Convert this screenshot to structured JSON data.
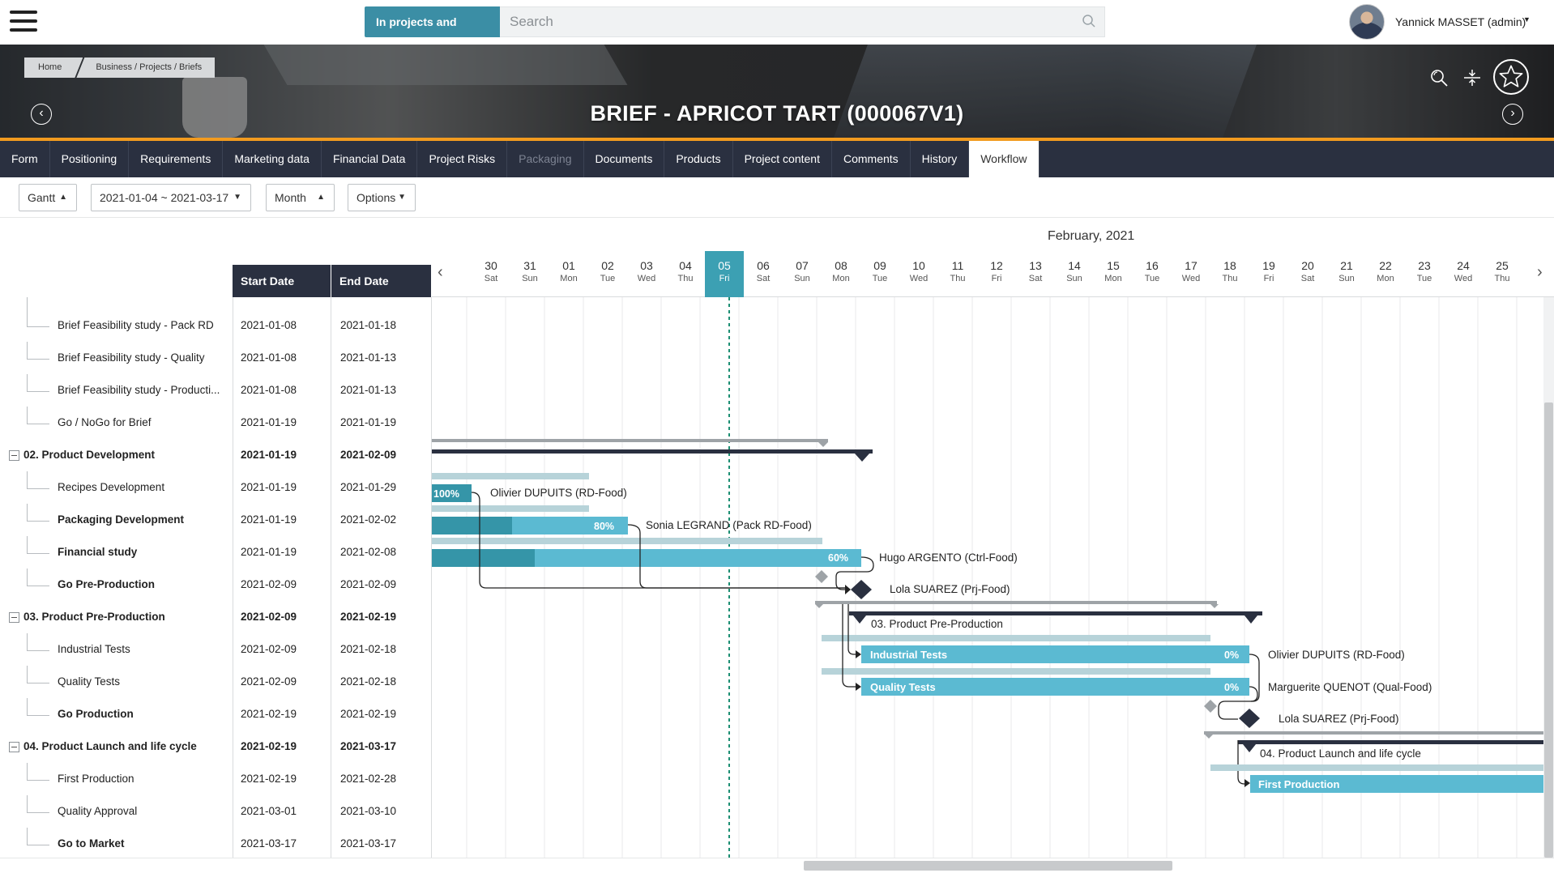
{
  "topbar": {
    "search_scope": "In projects and briefs",
    "search_placeholder": "Search",
    "user_name": "Yannick MASSET (admin)"
  },
  "banner": {
    "breadcrumb": [
      "Home",
      "Business / Projects / Briefs"
    ],
    "title": "BRIEF - APRICOT TART (000067V1)"
  },
  "tabs": [
    {
      "label": "Form",
      "state": "normal"
    },
    {
      "label": "Positioning",
      "state": "normal"
    },
    {
      "label": "Requirements",
      "state": "normal"
    },
    {
      "label": "Marketing data",
      "state": "normal"
    },
    {
      "label": "Financial Data",
      "state": "normal"
    },
    {
      "label": "Project Risks",
      "state": "normal"
    },
    {
      "label": "Packaging",
      "state": "disabled"
    },
    {
      "label": "Documents",
      "state": "normal"
    },
    {
      "label": "Products",
      "state": "normal"
    },
    {
      "label": "Project content",
      "state": "normal"
    },
    {
      "label": "Comments",
      "state": "normal"
    },
    {
      "label": "History",
      "state": "normal"
    },
    {
      "label": "Workflow",
      "state": "active"
    }
  ],
  "toolbar": {
    "view": "Gantt",
    "date_range": "2021-01-04 ~ 2021-03-17",
    "scale": "Month",
    "options": "Options"
  },
  "gantt": {
    "month_title": "February, 2021",
    "columns": {
      "start": "Start Date",
      "end": "End Date"
    },
    "days": [
      {
        "n": "30",
        "w": "Sat"
      },
      {
        "n": "31",
        "w": "Sun"
      },
      {
        "n": "01",
        "w": "Mon"
      },
      {
        "n": "02",
        "w": "Tue"
      },
      {
        "n": "03",
        "w": "Wed"
      },
      {
        "n": "04",
        "w": "Thu"
      },
      {
        "n": "05",
        "w": "Fri",
        "today": true
      },
      {
        "n": "06",
        "w": "Sat"
      },
      {
        "n": "07",
        "w": "Sun"
      },
      {
        "n": "08",
        "w": "Mon"
      },
      {
        "n": "09",
        "w": "Tue"
      },
      {
        "n": "10",
        "w": "Wed"
      },
      {
        "n": "11",
        "w": "Thu"
      },
      {
        "n": "12",
        "w": "Fri"
      },
      {
        "n": "13",
        "w": "Sat"
      },
      {
        "n": "14",
        "w": "Sun"
      },
      {
        "n": "15",
        "w": "Mon"
      },
      {
        "n": "16",
        "w": "Tue"
      },
      {
        "n": "17",
        "w": "Wed"
      },
      {
        "n": "18",
        "w": "Thu"
      },
      {
        "n": "19",
        "w": "Fri"
      },
      {
        "n": "20",
        "w": "Sat"
      },
      {
        "n": "21",
        "w": "Sun"
      },
      {
        "n": "22",
        "w": "Mon"
      },
      {
        "n": "23",
        "w": "Tue"
      },
      {
        "n": "24",
        "w": "Wed"
      },
      {
        "n": "25",
        "w": "Thu"
      }
    ],
    "rows": [
      {
        "name": "Brief Feasibility study - Pack RD",
        "start": "2021-01-08",
        "end": "2021-01-18",
        "kind": "task"
      },
      {
        "name": "Brief Feasibility study - Quality",
        "start": "2021-01-08",
        "end": "2021-01-13",
        "kind": "task"
      },
      {
        "name": "Brief Feasibility study - Producti...",
        "start": "2021-01-08",
        "end": "2021-01-13",
        "kind": "task"
      },
      {
        "name": "Go / NoGo for Brief",
        "start": "2021-01-19",
        "end": "2021-01-19",
        "kind": "task"
      },
      {
        "name": "02. Product Development",
        "start": "2021-01-19",
        "end": "2021-02-09",
        "kind": "group"
      },
      {
        "name": "Recipes Development",
        "start": "2021-01-19",
        "end": "2021-01-29",
        "kind": "task"
      },
      {
        "name": "Packaging Development",
        "start": "2021-01-19",
        "end": "2021-02-02",
        "kind": "bold"
      },
      {
        "name": "Financial study",
        "start": "2021-01-19",
        "end": "2021-02-08",
        "kind": "bold"
      },
      {
        "name": "Go Pre-Production",
        "start": "2021-02-09",
        "end": "2021-02-09",
        "kind": "bold"
      },
      {
        "name": "03. Product Pre-Production",
        "start": "2021-02-09",
        "end": "2021-02-19",
        "kind": "group"
      },
      {
        "name": "Industrial Tests",
        "start": "2021-02-09",
        "end": "2021-02-18",
        "kind": "task"
      },
      {
        "name": "Quality Tests",
        "start": "2021-02-09",
        "end": "2021-02-18",
        "kind": "task"
      },
      {
        "name": "Go Production",
        "start": "2021-02-19",
        "end": "2021-02-19",
        "kind": "bold"
      },
      {
        "name": "04. Product Launch and life cycle",
        "start": "2021-02-19",
        "end": "2021-03-17",
        "kind": "group"
      },
      {
        "name": "First Production",
        "start": "2021-02-19",
        "end": "2021-02-28",
        "kind": "task"
      },
      {
        "name": "Quality Approval",
        "start": "2021-03-01",
        "end": "2021-03-10",
        "kind": "task"
      },
      {
        "name": "Go to Market",
        "start": "2021-03-17",
        "end": "2021-03-17",
        "kind": "bold"
      }
    ],
    "bars": [
      {
        "label": "100%",
        "resource": "Olivier DUPUITS (RD-Food)",
        "progress": 1.0
      },
      {
        "label": "80%",
        "resource": "Sonia LEGRAND (Pack RD-Food)",
        "progress": 0.8
      },
      {
        "label": "60%",
        "resource": "Hugo ARGENTO (Ctrl-Food)",
        "progress": 0.6
      },
      {
        "resource": "Lola SUAREZ (Prj-Food)"
      },
      {
        "group_label": "03. Product Pre-Production"
      },
      {
        "label": "Industrial Tests",
        "pct": "0%",
        "resource": "Olivier DUPUITS (RD-Food)",
        "progress": 0
      },
      {
        "label": "Quality Tests",
        "pct": "0%",
        "resource": "Marguerite QUENOT (Qual-Food)",
        "progress": 0
      },
      {
        "resource": "Lola SUAREZ (Prj-Food)"
      },
      {
        "group_label": "04. Product Launch and life cycle"
      },
      {
        "label": "First Production"
      }
    ]
  },
  "colors": {
    "accent": "#3b8ea5",
    "nav_bg": "#2a3040",
    "orange": "#f29b1f",
    "bar": "#5bbad2",
    "bar_done": "#3595a8",
    "baseline": "#b7d3d9",
    "summary": "#2a3040"
  }
}
